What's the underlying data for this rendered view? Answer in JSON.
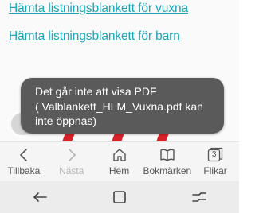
{
  "page": {
    "link_adult": "Hämta listningsblankett för vuxna",
    "link_children": "Hämta listningsblankett för barn"
  },
  "toast": {
    "title": "Det går inte att visa PDF",
    "message": "( Valblankett_HLM_Vuxna.pdf kan inte öppnas)"
  },
  "toolbar": {
    "items": [
      {
        "label": "Tillbaka",
        "icon": "chevron-left-icon",
        "enabled": true
      },
      {
        "label": "Nästa",
        "icon": "chevron-right-icon",
        "enabled": false
      },
      {
        "label": "Hem",
        "icon": "home-icon",
        "enabled": true
      },
      {
        "label": "Bokmärken",
        "icon": "bookmark-book-icon",
        "enabled": true
      },
      {
        "label": "Flikar",
        "icon": "tabs-icon",
        "enabled": true
      }
    ],
    "tab_count": "3"
  },
  "system_nav": {
    "buttons": [
      "back-icon",
      "home-square-icon",
      "recents-icon"
    ]
  },
  "colors": {
    "link": "#1aa6b7",
    "toast_bg": "#5a5a5a",
    "toolbar_bg": "#f5f5f5",
    "navbar_bg": "#ececec",
    "accent_red": "#d8202a"
  }
}
